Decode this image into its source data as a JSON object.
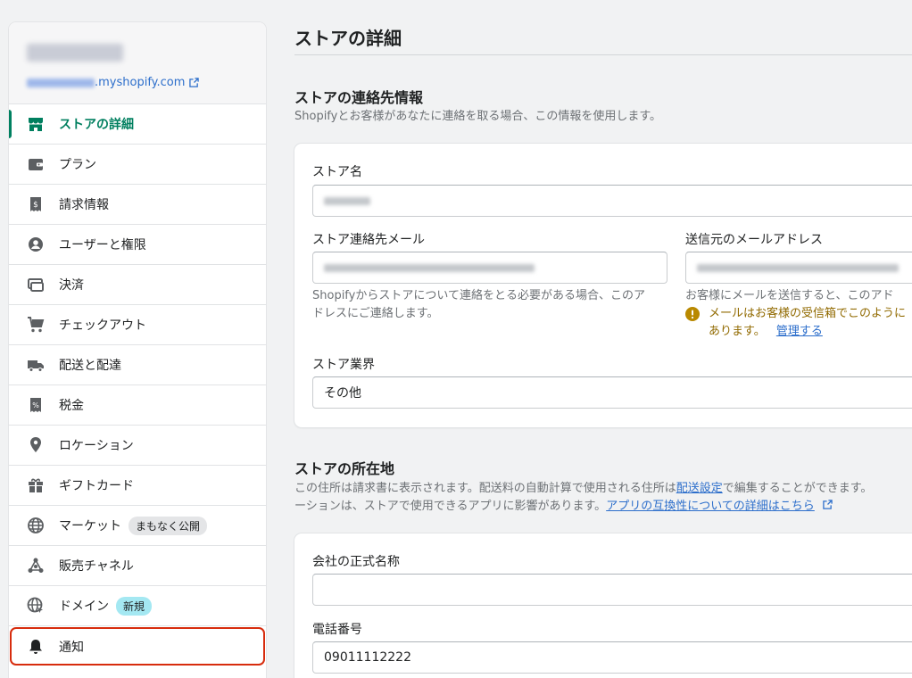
{
  "sidebar": {
    "store_url_suffix": ".myshopify.com",
    "items": [
      {
        "label": "ストアの詳細"
      },
      {
        "label": "プラン"
      },
      {
        "label": "請求情報"
      },
      {
        "label": "ユーザーと権限"
      },
      {
        "label": "決済"
      },
      {
        "label": "チェックアウト"
      },
      {
        "label": "配送と配達"
      },
      {
        "label": "税金"
      },
      {
        "label": "ロケーション"
      },
      {
        "label": "ギフトカード"
      },
      {
        "label": "マーケット",
        "badge": "まもなく公開"
      },
      {
        "label": "販売チャネル"
      },
      {
        "label": "ドメイン",
        "badge": "新規"
      },
      {
        "label": "通知"
      }
    ]
  },
  "page": {
    "title": "ストアの詳細"
  },
  "contact": {
    "title": "ストアの連絡先情報",
    "desc": "Shopifyとお客様があなたに連絡を取る場合、この情報を使用します。",
    "store_name_label": "ストア名",
    "email_label": "ストア連絡先メール",
    "email_help_1": "Shopifyからストアについて連絡をとる必要がある場合、このア",
    "email_help_2": "ドレスにご連絡します。",
    "sender_label": "送信元のメールアドレス",
    "sender_help": "お客様にメールを送信すると、このアド",
    "sender_warn_1": "メールはお客様の受信箱でこのように",
    "sender_warn_2": "あります。",
    "manage_link": "管理する",
    "industry_label": "ストア業界",
    "industry_value": "その他"
  },
  "address": {
    "title": "ストアの所在地",
    "desc_1a": "この住所は請求書に表示されます。配送料の自動計算で使用される住所は",
    "desc_1_link": "配送設定",
    "desc_1b": "で編集することができます。",
    "desc_2a": "ーションは、ストアで使用できるアプリに影響があります。",
    "desc_2_link": "アプリの互換性についての詳細はこちら",
    "company_label": "会社の正式名称",
    "phone_label": "電話番号",
    "phone_value": "09011112222"
  },
  "colors": {
    "accent": "#008060",
    "link": "#2c6ecb",
    "warning": "#916a00",
    "highlight": "#d72c0d"
  }
}
